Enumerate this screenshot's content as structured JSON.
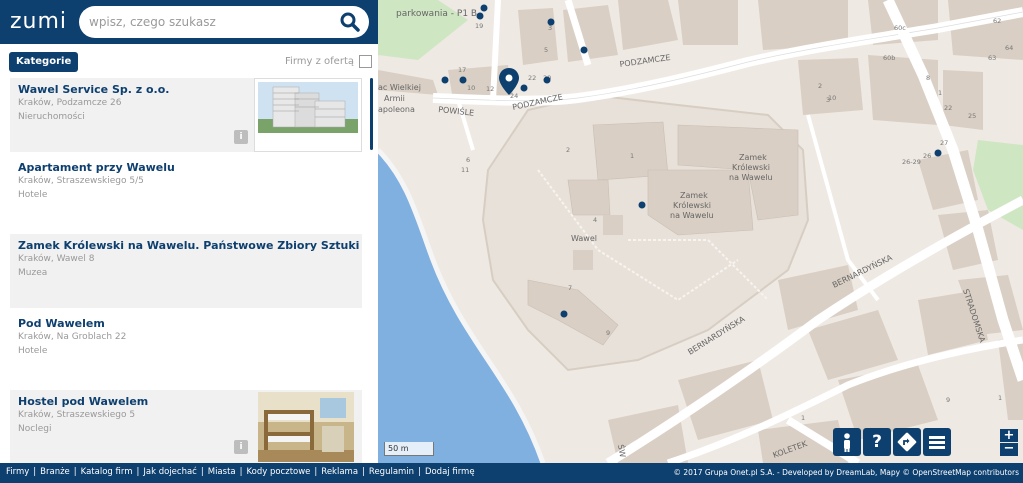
{
  "header": {
    "logo": "zumi",
    "search_placeholder": "wpisz, czego szukasz"
  },
  "filters": {
    "kategorie_label": "Kategorie",
    "firmy_label": "Firmy z ofertą"
  },
  "results": [
    {
      "title": "Wawel Service Sp. z o.o.",
      "address": "Kraków, Podzamcze 26",
      "category": "Nieruchomości",
      "has_photo": true,
      "photo_icon": "building-photo"
    },
    {
      "title": "Apartament przy Wawelu",
      "address": "Kraków, Straszewskiego 5/5",
      "category": "Hotele",
      "has_photo": false
    },
    {
      "title": "Zamek Królewski na Wawelu. Państwowe Zbiory Sztuki",
      "address": "Kraków, Wawel 8",
      "category": "Muzea",
      "has_photo": false
    },
    {
      "title": "Pod Wawelem",
      "address": "Kraków, Na Groblach 22",
      "category": "Hotele",
      "has_photo": false
    },
    {
      "title": "Hostel pod Wawelem",
      "address": "Kraków, Straszewskiego 5",
      "category": "Noclegi",
      "has_photo": true,
      "photo_icon": "hostel-room-photo"
    }
  ],
  "info_badge": "i",
  "map": {
    "labels": {
      "parking": "parkowania - P1 B",
      "podzamcze_top": "PODZAMCZE",
      "podzamcze": "PODZAMCZE",
      "powisle": "POWIŚLE",
      "wielkiej": "ac Wielkiej",
      "armii": "Armii",
      "napoleona": "apoleona",
      "wawel": "Wawel",
      "zamek1_line1": "Zamek",
      "zamek1_line2": "Królewski",
      "zamek1_line3": "na Wawelu",
      "zamek2_line1": "Zamek",
      "zamek2_line2": "Królewski",
      "zamek2_line3": "na Wawelu",
      "bernardynska_top": "BERNARDYŃSKA",
      "bernardynska": "BERNARDYŃSKA",
      "stradomska": "STRADOMSKA",
      "koletek": "KOLETEK",
      "sw": "ŚW"
    },
    "numbers": [
      "19",
      "3",
      "5",
      "17",
      "12",
      "10",
      "2",
      "22",
      "20",
      "24",
      "6",
      "11",
      "1",
      "2",
      "9",
      "7",
      "4",
      "10",
      "2",
      "1",
      "8",
      "22",
      "27",
      "26",
      "26-29",
      "25",
      "60b",
      "60c",
      "62",
      "64",
      "63",
      "3",
      "1",
      "1",
      "9"
    ],
    "scale": "50 m",
    "colors": {
      "water": "#7fb0e0",
      "building": "#d9cfc4",
      "road": "#ffffff",
      "park": "#c8e6b8",
      "poi": "#0d3f6f"
    }
  },
  "map_controls": {
    "person_icon": "person-icon",
    "help_label": "?",
    "directions_icon": "directions-icon",
    "menu_icon": "menu-icon",
    "zoom_in": "+",
    "zoom_out": "−"
  },
  "footer": {
    "links": [
      "Firmy",
      "Branże",
      "Katalog firm",
      "Jak dojechać",
      "Miasta",
      "Kody pocztowe",
      "Reklama",
      "Regulamin",
      "Dodaj firmę"
    ],
    "copyright": "© 2017 Grupa Onet.pl S.A. - Developed by DreamLab, Mapy © OpenStreetMap contributors"
  }
}
